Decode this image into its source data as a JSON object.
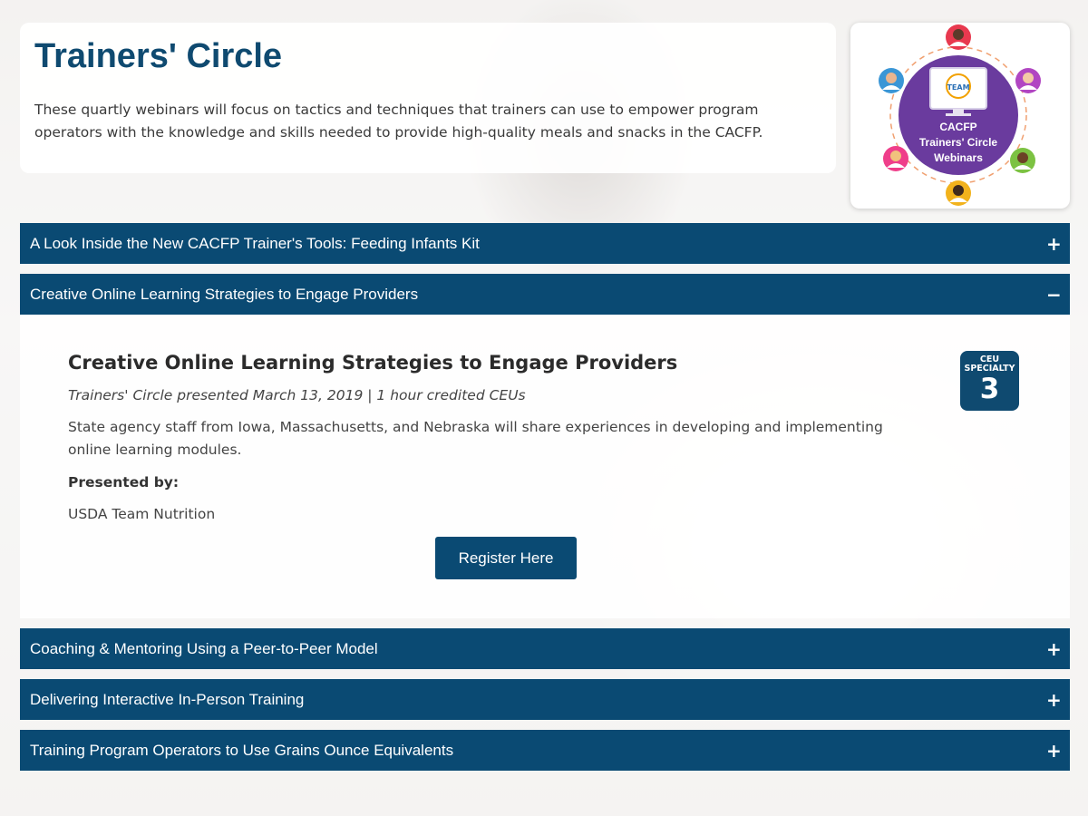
{
  "header": {
    "title": "Trainers' Circle",
    "description": "These quartly webinars will focus on tactics and techniques that trainers can use to empower program operators with the knowledge and skills needed to provide high-quality meals and snacks in the CACFP."
  },
  "logo": {
    "line1": "CACFP",
    "line2": "Trainers' Circle",
    "line3": "Webinars",
    "badge_text": "TEAM",
    "colors": {
      "circle": "#6a3b9e",
      "ring": "#f0a070"
    }
  },
  "accordion": {
    "items": [
      {
        "title": "A Look Inside the New CACFP Trainer's Tools: Feeding Infants Kit",
        "sign": "+"
      },
      {
        "title": "Creative Online Learning Strategies to Engage Providers",
        "sign": "−"
      },
      {
        "title": "Coaching & Mentoring Using a Peer-to-Peer Model",
        "sign": "+"
      },
      {
        "title": "Delivering Interactive In-Person Training",
        "sign": "+"
      },
      {
        "title": "Training Program Operators to Use Grains Ounce Equivalents",
        "sign": "+"
      }
    ],
    "expanded": {
      "heading": "Creative Online Learning Strategies to Engage Providers",
      "meta": "Trainers' Circle presented March 13, 2019 | 1 hour credited CEUs",
      "description": "State agency staff from Iowa, Massachusetts, and Nebraska will share experiences in developing and implementing online learning modules.",
      "presented_by_label": "Presented by:",
      "presenter": "USDA Team Nutrition",
      "register_label": "Register Here",
      "ceu": {
        "line1": "CEU",
        "line2": "SPECIALTY",
        "number": "3"
      }
    }
  },
  "colors": {
    "primary": "#0a4a73",
    "title": "#0f4a70"
  }
}
